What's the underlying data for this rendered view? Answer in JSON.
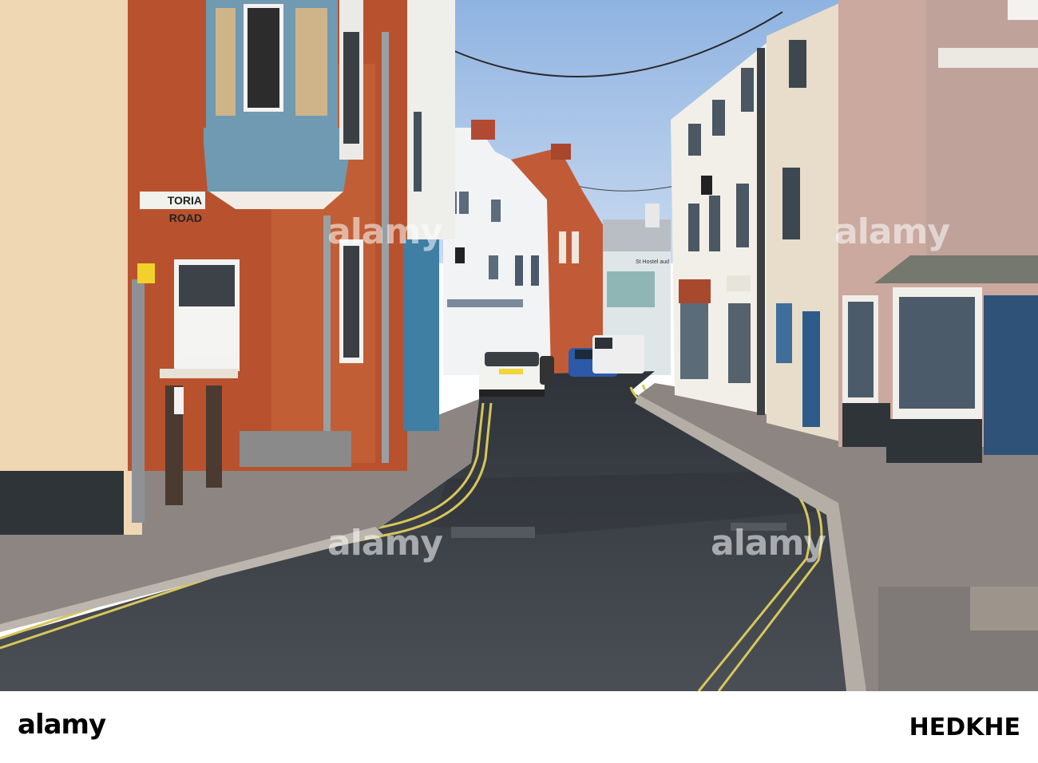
{
  "photo": {
    "street_sign": "TORIA ROAD",
    "shop_sign_right": "St Hostel aud"
  },
  "watermark": {
    "text": "alamy",
    "stock_code": "HEDKHE"
  },
  "colors": {
    "sky": "#a7c3e7",
    "brick": "#b8522e",
    "bay_window_blue": "#6f9ab1",
    "road": "#3b4046",
    "pavement": "#8d8582",
    "yellow_lines": "#d8c65a",
    "cream_wall": "#efd7b3"
  }
}
